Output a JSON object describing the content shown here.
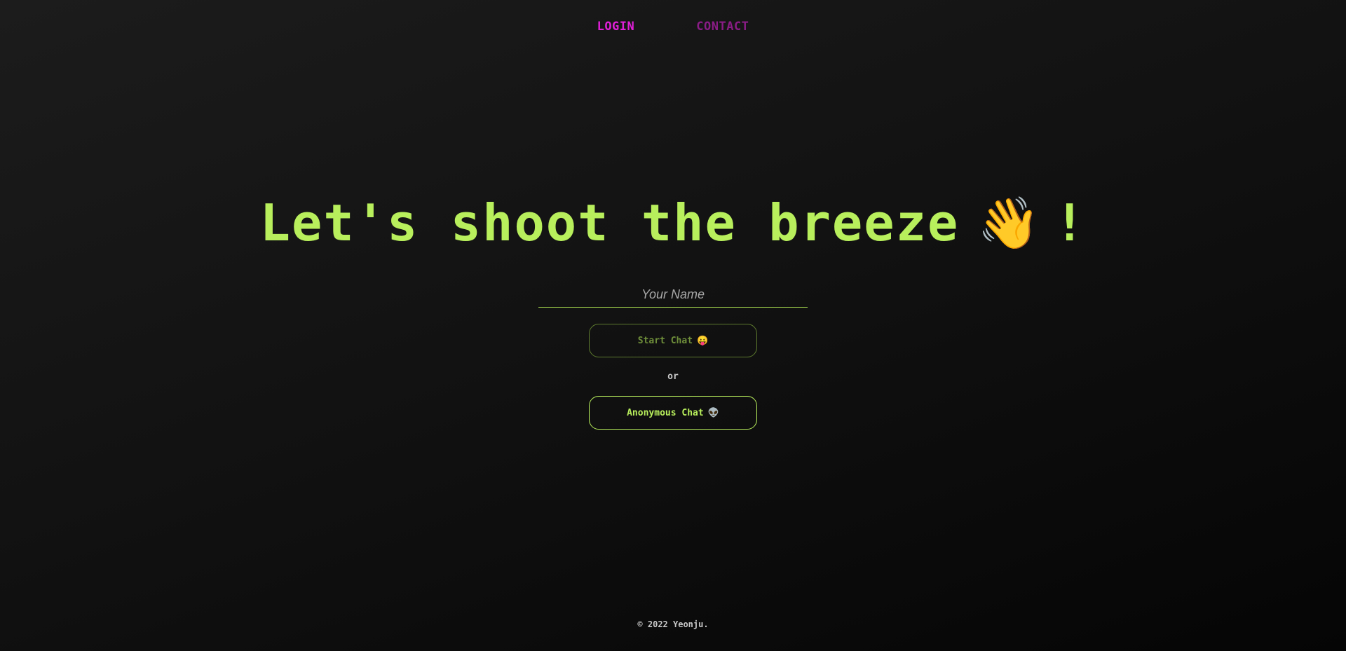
{
  "nav": {
    "login_label": "LOGIN",
    "contact_label": "CONTACT"
  },
  "hero": {
    "headline": "Let's shoot the breeze",
    "wave_emoji": "👋",
    "exclamation": "!"
  },
  "form": {
    "name_placeholder": "Your Name",
    "name_value": "",
    "start_chat_label": "Start Chat",
    "start_chat_emoji": "😛",
    "or_text": "or",
    "anonymous_chat_label": "Anonymous Chat",
    "anonymous_chat_emoji": "👽"
  },
  "footer": {
    "copyright": "© 2022 Yeonju."
  },
  "colors": {
    "accent_green": "#b8ef5c",
    "nav_magenta": "#e020d8",
    "nav_magenta_dim": "#8a1c86",
    "background": "#111111"
  }
}
